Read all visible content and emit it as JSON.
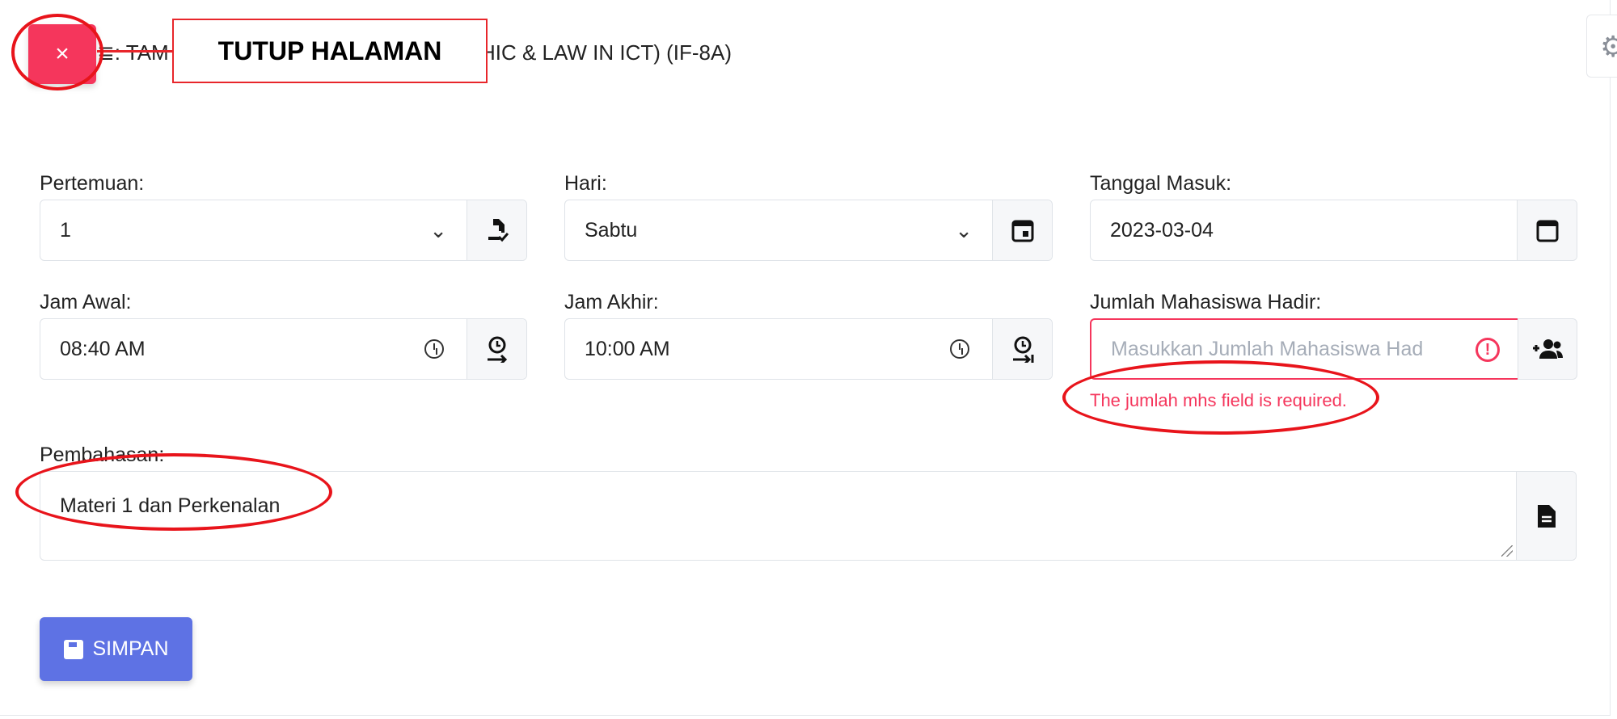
{
  "header": {
    "close_glyph": "×",
    "title_left": "≣: TAM",
    "title_right": "PROFESI (ETHIC & LAW IN ICT) (IF-8A)",
    "callout": "TUTUP HALAMAN"
  },
  "form": {
    "pertemuan": {
      "label": "Pertemuan:",
      "value": "1"
    },
    "hari": {
      "label": "Hari:",
      "value": "Sabtu"
    },
    "tanggal_masuk": {
      "label": "Tanggal Masuk:",
      "value": "2023-03-04"
    },
    "jam_awal": {
      "label": "Jam Awal:",
      "value": "08:40  AM"
    },
    "jam_akhir": {
      "label": "Jam Akhir:",
      "value": "10:00  AM"
    },
    "jumlah_mhs": {
      "label": "Jumlah Mahasiswa Hadir:",
      "placeholder": "Masukkan Jumlah Mahasiswa Had",
      "error": "The jumlah mhs field is required."
    },
    "pembahasan": {
      "label": "Pembahasan:",
      "value": "Materi 1 dan Perkenalan"
    }
  },
  "save_label": "SIMPAN",
  "colors": {
    "danger": "#f5365c",
    "primary": "#5e72e4",
    "annotation": "#e8141b"
  },
  "icons": [
    "close-icon",
    "file-check-icon",
    "calendar-day-icon",
    "calendar-icon",
    "clock-icon",
    "clock-start-icon",
    "clock-end-icon",
    "alert-circle-icon",
    "user-plus-icon",
    "file-text-icon",
    "save-icon",
    "gear-icon"
  ]
}
